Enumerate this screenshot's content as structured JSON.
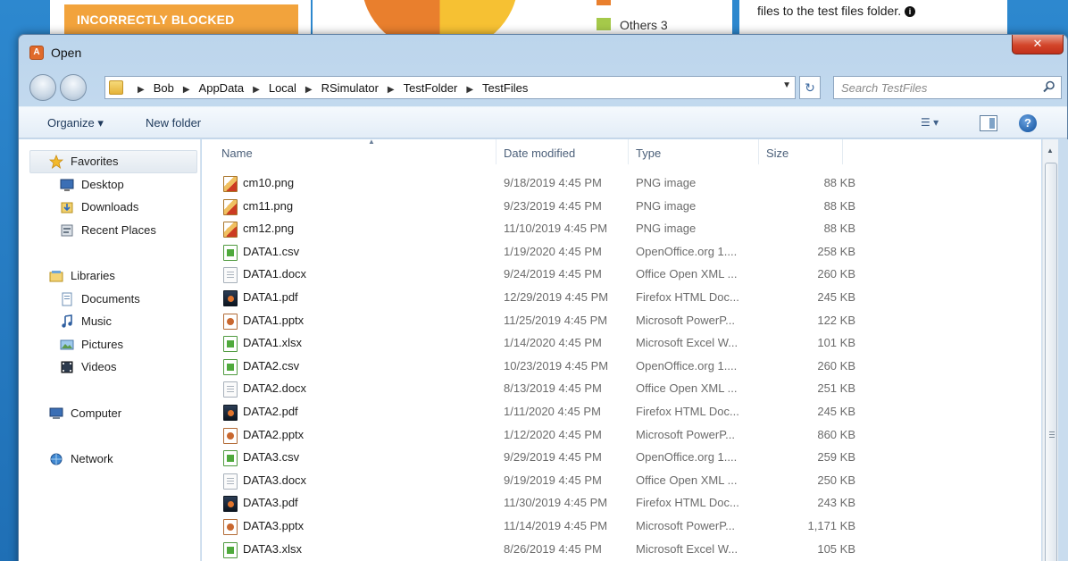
{
  "background": {
    "blocked_label": "INCORRECTLY BLOCKED",
    "legend_others": "Others 3",
    "right_text": "files to the test files folder."
  },
  "dialog": {
    "title": "Open",
    "close_glyph": "✕",
    "breadcrumbs": [
      "Bob",
      "AppData",
      "Local",
      "RSimulator",
      "TestFolder",
      "TestFiles"
    ],
    "search_placeholder": "Search TestFiles",
    "toolbar": {
      "organize": "Organize ▾",
      "new_folder": "New folder",
      "help": "?"
    },
    "nav": {
      "favorites": "Favorites",
      "desktop": "Desktop",
      "downloads": "Downloads",
      "recent": "Recent Places",
      "libraries": "Libraries",
      "documents": "Documents",
      "music": "Music",
      "pictures": "Pictures",
      "videos": "Videos",
      "computer": "Computer",
      "network": "Network"
    },
    "columns": {
      "name": "Name",
      "date": "Date modified",
      "type": "Type",
      "size": "Size"
    },
    "files": [
      {
        "name": "cm10.png",
        "date": "9/18/2019 4:45 PM",
        "type": "PNG image",
        "size": "88 KB",
        "kind": "png"
      },
      {
        "name": "cm11.png",
        "date": "9/23/2019 4:45 PM",
        "type": "PNG image",
        "size": "88 KB",
        "kind": "png"
      },
      {
        "name": "cm12.png",
        "date": "11/10/2019 4:45 PM",
        "type": "PNG image",
        "size": "88 KB",
        "kind": "png"
      },
      {
        "name": "DATA1.csv",
        "date": "1/19/2020 4:45 PM",
        "type": "OpenOffice.org 1....",
        "size": "258 KB",
        "kind": "csv"
      },
      {
        "name": "DATA1.docx",
        "date": "9/24/2019 4:45 PM",
        "type": "Office Open XML ...",
        "size": "260 KB",
        "kind": "docx"
      },
      {
        "name": "DATA1.pdf",
        "date": "12/29/2019 4:45 PM",
        "type": "Firefox HTML Doc...",
        "size": "245 KB",
        "kind": "pdf"
      },
      {
        "name": "DATA1.pptx",
        "date": "11/25/2019 4:45 PM",
        "type": "Microsoft PowerP...",
        "size": "122 KB",
        "kind": "pptx"
      },
      {
        "name": "DATA1.xlsx",
        "date": "1/14/2020 4:45 PM",
        "type": "Microsoft Excel W...",
        "size": "101 KB",
        "kind": "xlsx"
      },
      {
        "name": "DATA2.csv",
        "date": "10/23/2019 4:45 PM",
        "type": "OpenOffice.org 1....",
        "size": "260 KB",
        "kind": "csv"
      },
      {
        "name": "DATA2.docx",
        "date": "8/13/2019 4:45 PM",
        "type": "Office Open XML ...",
        "size": "251 KB",
        "kind": "docx"
      },
      {
        "name": "DATA2.pdf",
        "date": "1/11/2020 4:45 PM",
        "type": "Firefox HTML Doc...",
        "size": "245 KB",
        "kind": "pdf"
      },
      {
        "name": "DATA2.pptx",
        "date": "1/12/2020 4:45 PM",
        "type": "Microsoft PowerP...",
        "size": "860 KB",
        "kind": "pptx"
      },
      {
        "name": "DATA3.csv",
        "date": "9/29/2019 4:45 PM",
        "type": "OpenOffice.org 1....",
        "size": "259 KB",
        "kind": "csv"
      },
      {
        "name": "DATA3.docx",
        "date": "9/19/2019 4:45 PM",
        "type": "Office Open XML ...",
        "size": "250 KB",
        "kind": "docx"
      },
      {
        "name": "DATA3.pdf",
        "date": "11/30/2019 4:45 PM",
        "type": "Firefox HTML Doc...",
        "size": "243 KB",
        "kind": "pdf"
      },
      {
        "name": "DATA3.pptx",
        "date": "11/14/2019 4:45 PM",
        "type": "Microsoft PowerP...",
        "size": "1,171 KB",
        "kind": "pptx"
      },
      {
        "name": "DATA3.xlsx",
        "date": "8/26/2019 4:45 PM",
        "type": "Microsoft Excel W...",
        "size": "105 KB",
        "kind": "xlsx"
      }
    ]
  }
}
